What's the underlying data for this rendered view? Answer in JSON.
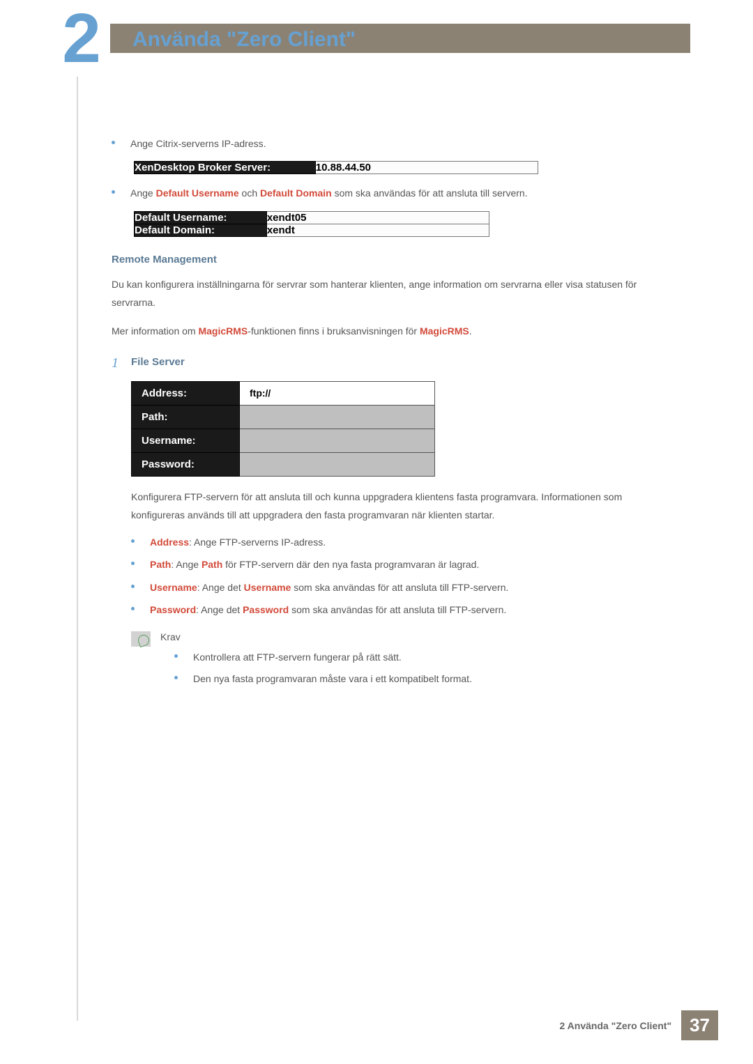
{
  "chapter": {
    "number": "2",
    "title": "Använda \"Zero Client\""
  },
  "citrix": {
    "bullet1": "Ange Citrix-serverns IP-adress.",
    "table1": {
      "label": "XenDesktop Broker Server:",
      "value": "10.88.44.50"
    },
    "bullet2_pre": "Ange ",
    "bullet2_strong1": "Default Username",
    "bullet2_mid": " och ",
    "bullet2_strong2": "Default Domain",
    "bullet2_post": " som ska användas för att ansluta till servern.",
    "table2": {
      "r1label": "Default Username:",
      "r1value": "xendt05",
      "r2label": "Default Domain:",
      "r2value": "xendt"
    }
  },
  "remote": {
    "heading": "Remote Management",
    "para1": "Du kan konfigurera inställningarna för servrar som hanterar klienten, ange information om servrarna eller visa statusen för servrarna.",
    "para2_pre": "Mer information om ",
    "para2_s1": "MagicRMS",
    "para2_mid": "-funktionen finns i bruksanvisningen för ",
    "para2_s2": "MagicRMS",
    "para2_post": "."
  },
  "step1": {
    "num": "1",
    "label": "File Server",
    "rows": {
      "address_label": "Address:",
      "address_value": "ftp://",
      "path_label": "Path:",
      "username_label": "Username:",
      "password_label": "Password:"
    },
    "desc": "Konfigurera FTP-servern för att ansluta till och kunna uppgradera klientens fasta programvara. Informationen som konfigureras används till att uppgradera den fasta programvaran när klienten startar.",
    "bullets": {
      "b1_s": "Address",
      "b1_t": ": Ange FTP-serverns IP-adress.",
      "b2_s": "Path",
      "b2_mid": ": Ange ",
      "b2_s2": "Path",
      "b2_t": " för FTP-servern där den nya fasta programvaran är lagrad.",
      "b3_s": "Username",
      "b3_mid": ": Ange det ",
      "b3_s2": "Username",
      "b3_t": " som ska användas för att ansluta till FTP-servern.",
      "b4_s": "Password",
      "b4_mid": ": Ange det ",
      "b4_s2": "Password",
      "b4_t": " som ska användas för att ansluta till FTP-servern."
    },
    "note": {
      "title": "Krav",
      "n1": "Kontrollera att FTP-servern fungerar på rätt sätt.",
      "n2": "Den nya fasta programvaran måste vara i ett kompatibelt format."
    }
  },
  "footer": {
    "text": "2 Använda \"Zero Client\"",
    "page": "37"
  }
}
